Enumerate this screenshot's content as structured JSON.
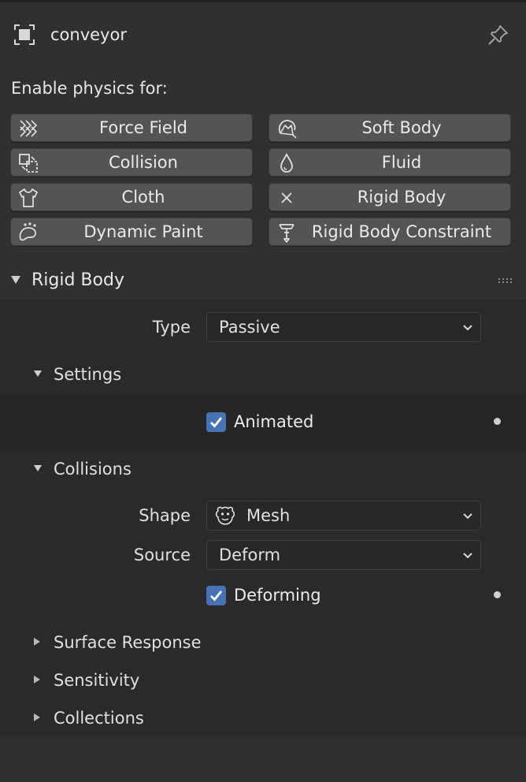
{
  "header": {
    "object_name": "conveyor",
    "object_icon": "object-icon",
    "pin_icon": "pin-icon"
  },
  "physics": {
    "enable_label": "Enable physics for:",
    "buttons": [
      {
        "label": "Force Field",
        "icon": "force-field-icon"
      },
      {
        "label": "Soft Body",
        "icon": "soft-body-icon"
      },
      {
        "label": "Collision",
        "icon": "collision-icon"
      },
      {
        "label": "Fluid",
        "icon": "fluid-icon"
      },
      {
        "label": "Cloth",
        "icon": "cloth-icon"
      },
      {
        "label": "Rigid Body",
        "icon": "rigid-body-x-icon"
      },
      {
        "label": "Dynamic Paint",
        "icon": "dynamic-paint-icon"
      },
      {
        "label": "Rigid Body Constraint",
        "icon": "rigid-body-constraint-icon"
      }
    ]
  },
  "rigid_body": {
    "title": "Rigid Body",
    "type_label": "Type",
    "type_value": "Passive",
    "settings": {
      "title": "Settings",
      "animated_label": "Animated",
      "animated_checked": true
    },
    "collisions": {
      "title": "Collisions",
      "shape_label": "Shape",
      "shape_value": "Mesh",
      "source_label": "Source",
      "source_value": "Deform",
      "deforming_label": "Deforming",
      "deforming_checked": true
    },
    "surface_response": {
      "title": "Surface Response"
    },
    "sensitivity": {
      "title": "Sensitivity"
    },
    "collections": {
      "title": "Collections"
    }
  },
  "colors": {
    "accent_checkbox": "#4772b3",
    "button_bg": "#545454",
    "panel_bg": "#303030"
  }
}
